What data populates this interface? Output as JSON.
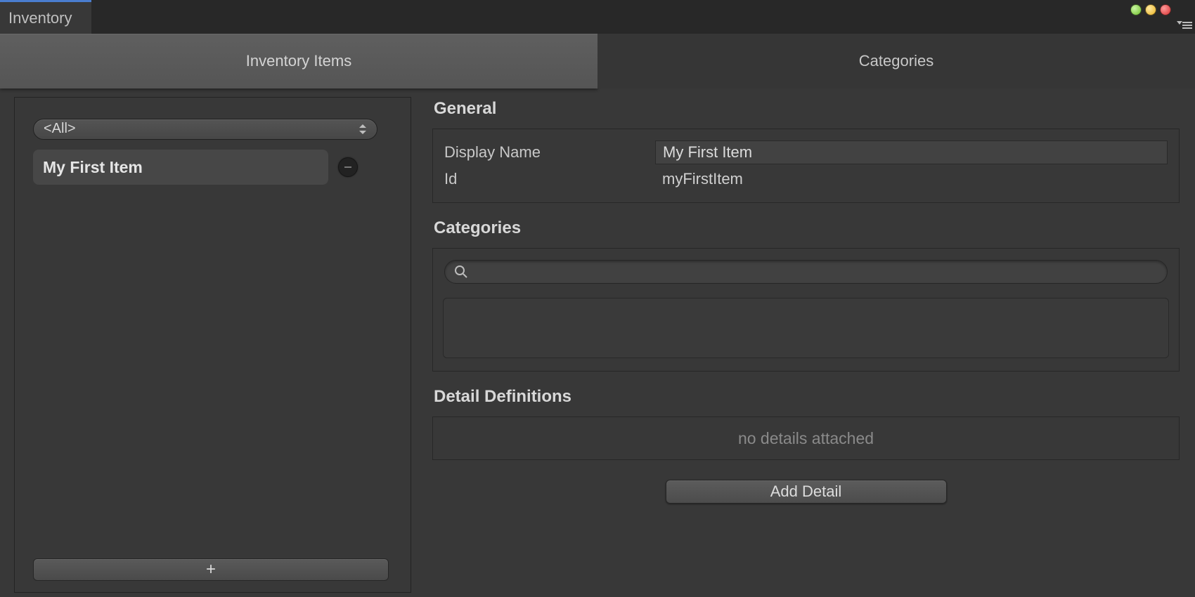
{
  "window": {
    "tab_title": "Inventory"
  },
  "tabs": {
    "inventory_items": "Inventory Items",
    "categories": "Categories",
    "active": "inventory_items"
  },
  "sidebar": {
    "filter_selected": "<All>",
    "items": [
      {
        "label": "My First Item"
      }
    ],
    "add_label": "+"
  },
  "general": {
    "section_title": "General",
    "display_name_label": "Display Name",
    "display_name_value": "My First Item",
    "id_label": "Id",
    "id_value": "myFirstItem"
  },
  "item_categories": {
    "section_title": "Categories",
    "search_value": ""
  },
  "detail_definitions": {
    "section_title": "Detail Definitions",
    "empty_text": "no details attached",
    "add_detail_label": "Add Detail"
  }
}
